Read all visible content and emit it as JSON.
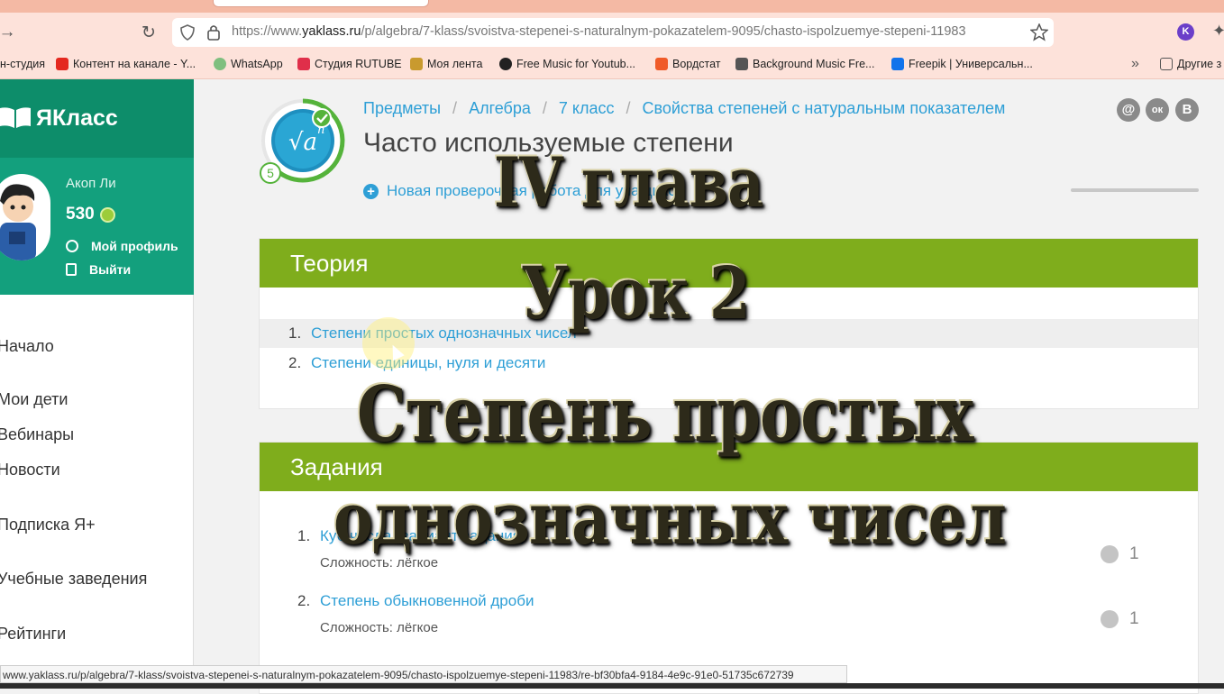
{
  "browser": {
    "url_prefix": "https://www.",
    "url_domain": "yaklass.ru",
    "url_path": "/p/algebra/7-klass/svoistva-stepenei-s-naturalnym-pokazatelem-9095/chasto-ispolzuemye-stepeni-11983",
    "profile_letter": "K",
    "bookmarks": [
      {
        "label": "н-студия",
        "color": ""
      },
      {
        "label": "Контент на канале - Y...",
        "color": "#e4281f"
      },
      {
        "label": "WhatsApp",
        "color": "#7fbf7f"
      },
      {
        "label": "Студия RUTUBE",
        "color": "#e02f4a"
      },
      {
        "label": "Моя лента",
        "color": "#c99a2e"
      },
      {
        "label": "Free Music for Youtub...",
        "color": "#222222"
      },
      {
        "label": "Вордстат",
        "color": "#f05a28"
      },
      {
        "label": "Background Music Fre...",
        "color": "#555555"
      },
      {
        "label": "Freepik | Универсальн...",
        "color": "#1273eb"
      }
    ],
    "other_bookmarks": "Другие з",
    "status_url": "www.yaklass.ru/p/algebra/7-klass/svoistva-stepenei-s-naturalnym-pokazatelem-9095/chasto-ispolzuemye-stepeni-11983/re-bf30bfa4-9184-4e9c-91e0-51735c672739"
  },
  "sidebar": {
    "logo": "ЯКласс",
    "user_name": "Акоп Ли",
    "points": "530",
    "profile_link": "Мой профиль",
    "logout_link": "Выйти",
    "nav": [
      "Начало",
      "Мои дети",
      "Вебинары",
      "Новости",
      "Подписка Я+",
      "Учебные заведения",
      "Рейтинги"
    ]
  },
  "page": {
    "breadcrumbs": [
      "Предметы",
      "Алгебра",
      "7 класс",
      "Свойства степеней с натуральным показателем"
    ],
    "title": "Часто используемые степени",
    "badge_level": "5",
    "new_check_link": "Новая проверочная работа для учащихся",
    "social": [
      "@",
      "ок",
      "В"
    ]
  },
  "theory": {
    "heading": "Теория",
    "items": [
      {
        "num": "1.",
        "text": "Степени простых однозначных чисел"
      },
      {
        "num": "2.",
        "text": "Степени единицы, нуля и десяти"
      }
    ]
  },
  "tasks": {
    "heading": "Задания",
    "items": [
      {
        "num": "1.",
        "text": "Куб числа (вариант задания)",
        "difficulty": "Сложность: лёгкое",
        "score": "1"
      },
      {
        "num": "2.",
        "text": "Степень обыкновенной дроби",
        "difficulty": "Сложность: лёгкое",
        "score": "1"
      }
    ]
  },
  "overlay": {
    "line1": "IV глава",
    "line2": "Урок 2",
    "line3": "Степень простых",
    "line4": "однозначных чисел"
  },
  "colors": {
    "green_header": "#7fad1c",
    "logo_bg": "#0d8d6a",
    "link": "#2e9fd6"
  }
}
